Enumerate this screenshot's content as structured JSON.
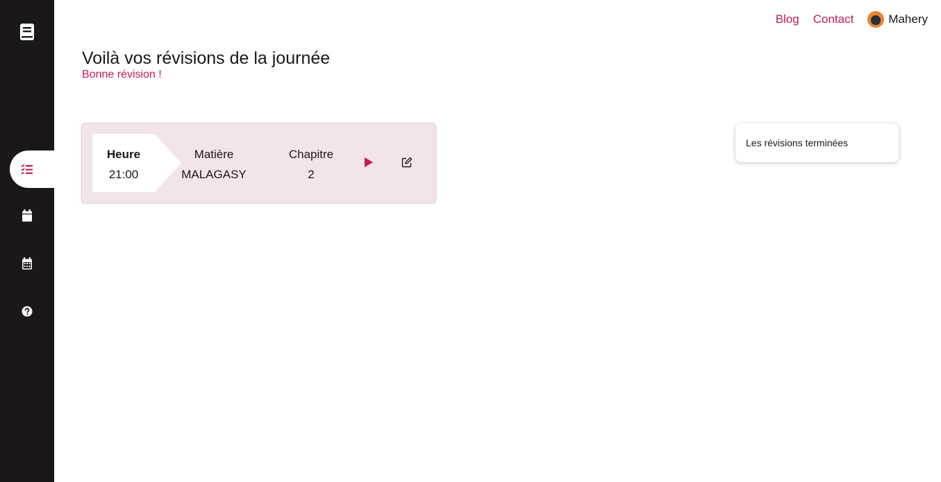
{
  "nav": {
    "blog": "Blog",
    "contact": "Contact",
    "user_name": "Mahery"
  },
  "header": {
    "title": "Voilà vos révisions de la journée",
    "subtitle": "Bonne révision !"
  },
  "revision": {
    "heure_label": "Heure",
    "heure_value": "21:00",
    "matiere_label": "Matière",
    "matiere_value": "MALAGASY",
    "chapitre_label": "Chapitre",
    "chapitre_value": "2"
  },
  "completed": {
    "label": "Les révisions terminées"
  },
  "sidebar": {
    "items": [
      {
        "icon": "book-icon"
      },
      {
        "icon": "task-list-icon",
        "active": true
      },
      {
        "icon": "calendar-icon"
      },
      {
        "icon": "calendar-days-icon"
      },
      {
        "icon": "help-icon"
      }
    ]
  },
  "colors": {
    "accent": "#c2185b",
    "sidebar": "#1c1719",
    "card": "#f3e4e9"
  }
}
